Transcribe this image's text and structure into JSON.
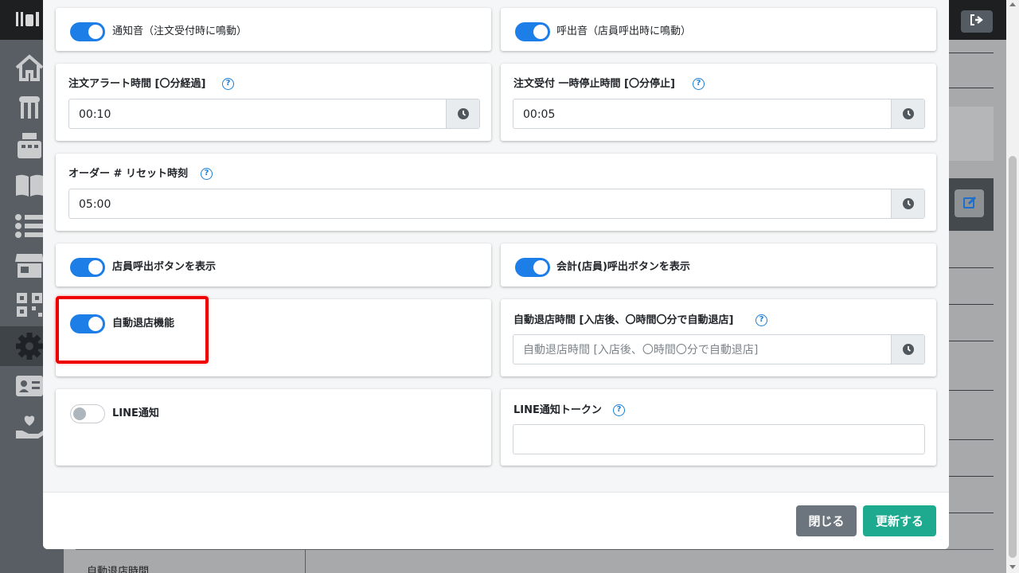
{
  "colors": {
    "toggle_on": "#1d7ee8",
    "help_icon": "#1a7fd6",
    "highlight_border": "#ee0000",
    "close_button": "#6c757d",
    "update_button": "#1eaa8e"
  },
  "sidebar": {
    "icons": [
      "home-icon",
      "store-icon",
      "register-icon",
      "book-icon",
      "list-icon",
      "shop-icon",
      "qr-icon",
      "gear-icon",
      "id-card-icon",
      "hand-heart-icon"
    ],
    "active_icon": "gear-icon"
  },
  "background": {
    "table_label": "自動退店時間"
  },
  "settings": {
    "notify_sound": {
      "label": "通知音（注文受付時に鳴動）",
      "enabled": true
    },
    "call_sound": {
      "label": "呼出音（店員呼出時に鳴動）",
      "enabled": true
    },
    "order_alert": {
      "label": "注文アラート時間 [〇分経過]",
      "value": "00:10"
    },
    "pause_time": {
      "label": "注文受付 一時停止時間 [〇分停止]",
      "value": "00:05"
    },
    "order_reset": {
      "label": "オーダー # リセット時刻",
      "value": "05:00"
    },
    "staff_call_button": {
      "label": "店員呼出ボタンを表示",
      "enabled": true
    },
    "checkout_call_button": {
      "label": "会計(店員)呼出ボタンを表示",
      "enabled": true
    },
    "auto_checkout": {
      "label": "自動退店機能",
      "enabled": true
    },
    "auto_checkout_time": {
      "label": "自動退店時間 [入店後、〇時間〇分で自動退店]",
      "value": "",
      "placeholder": "自動退店時間 [入店後、〇時間〇分で自動退店]"
    },
    "line_notify": {
      "label": "LINE通知",
      "enabled": false
    },
    "line_token": {
      "label": "LINE通知トークン",
      "value": ""
    }
  },
  "footer": {
    "close_label": "閉じる",
    "update_label": "更新する"
  }
}
